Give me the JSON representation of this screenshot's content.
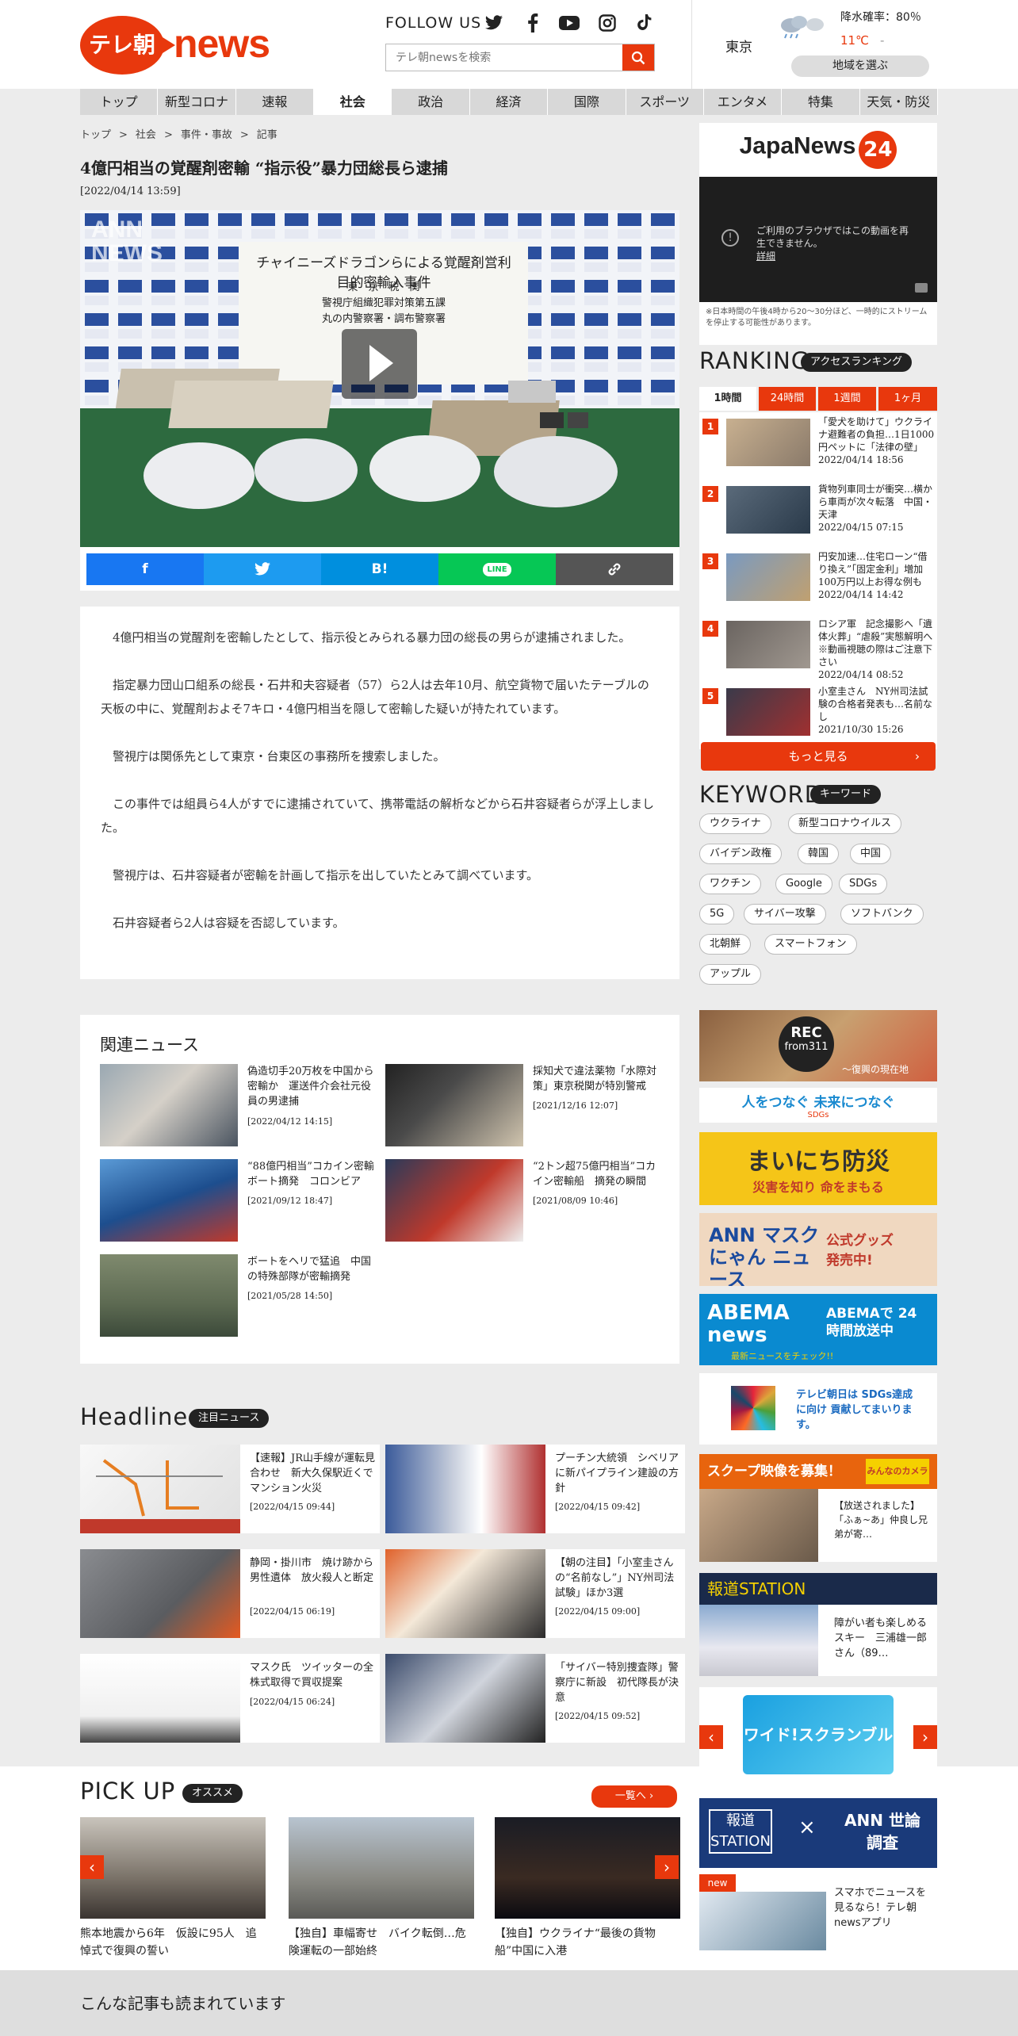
{
  "header": {
    "logo_jp": "テレ朝",
    "logo_news": "news",
    "follow": "FOLLOW US",
    "search_placeholder": "テレ朝newsを検索",
    "weather": {
      "city": "東京",
      "rain": "降水確率：80％",
      "temp": "11℃",
      "temp_low": "-",
      "region_button": "地域を選ぶ"
    }
  },
  "nav": [
    "トップ",
    "新型コロナ",
    "速報",
    "社会",
    "政治",
    "経済",
    "国際",
    "スポーツ",
    "エンタメ",
    "特集",
    "天気・防災"
  ],
  "breadcrumb": [
    "トップ",
    ">",
    "社会",
    ">",
    "事件・事故",
    ">",
    "記事"
  ],
  "article": {
    "title": "4億円相当の覚醒剤密輸 “指示役”暴力団総長ら逮捕",
    "date": "[2022/04/14 13:59]",
    "video_banner": "チャイニーズドラゴンらによる覚醒剤営利目的密輸入事件",
    "video_sub1": "東　京　税　関",
    "video_sub2": "警視庁組織犯罪対策第五課",
    "video_sub3": "丸の内警察署・調布警察署",
    "ann_logo": "ANN NEWS",
    "share_labels": {
      "facebook": "f",
      "twitter": "t",
      "hatena": "B!",
      "line": "LINE",
      "link": "🔗"
    },
    "paragraphs": [
      "4億円相当の覚醒剤を密輸したとして、指示役とみられる暴力団の総長の男らが逮捕されました。",
      "指定暴力団山口組系の総長・石井和夫容疑者（57）ら2人は去年10月、航空貨物で届いたテーブルの天板の中に、覚醒剤およそ7キロ・4億円相当を隠して密輸した疑いが持たれています。",
      "警視庁は関係先として東京・台東区の事務所を捜索しました。",
      "この事件では組員ら4人がすでに逮捕されていて、携帯電話の解析などから石井容疑者らが浮上しました。",
      "警視庁は、石井容疑者が密輸を計画して指示を出していたとみて調べています。",
      "石井容疑者ら2人は容疑を否認しています。"
    ]
  },
  "related": {
    "heading": "関連ニュース",
    "items": [
      {
        "title": "偽造切手20万枚を中国から密輸か　運送件介会社元役員の男逮捕",
        "date": "[2022/04/12 14:15]"
      },
      {
        "title": "採知犬で違法薬物「水際対策」東京税関が特別警戒",
        "date": "[2021/12/16 12:07]"
      },
      {
        "title": "“88億円相当”コカイン密輸ボート摘発　コロンビア",
        "date": "[2021/09/12 18:47]"
      },
      {
        "title": "“2トン超75億円相当”コカイン密輸船　摘発の瞬間",
        "date": "[2021/08/09 10:46]"
      },
      {
        "title": "ボートをヘリで猛追　中国の特殊部隊が密輸摘発",
        "date": "[2021/05/28 14:50]"
      }
    ]
  },
  "headline": {
    "heading": "Headline",
    "pill": "注目ニュース",
    "items": [
      {
        "title": "【速報】JR山手線が運転見合わせ　新大久保駅近くでマンション火災",
        "date": "[2022/04/15 09:44]"
      },
      {
        "title": "プーチン大統領　シベリアに新パイプライン建設の方針",
        "date": "[2022/04/15 09:42]"
      },
      {
        "title": "静岡・掛川市　焼け跡から男性遺体　放火殺人と断定",
        "date": "[2022/04/15 06:19]"
      },
      {
        "title": "【朝の注目】「小室圭さんの“名前なし”」NY州司法試験」ほか3選",
        "date": "[2022/04/15 09:00]"
      },
      {
        "title": "マスク氏　ツイッターの全株式取得で買収提案",
        "date": "[2022/04/15 06:24]"
      },
      {
        "title": "「サイバー特別捜査隊」警察庁に新設　初代隊長が決意",
        "date": "[2022/04/15 09:52]"
      }
    ]
  },
  "pickup": {
    "heading": "PICK UP",
    "pill": "オススメ",
    "more": "一覧へ",
    "items": [
      {
        "title": "熊本地震から6年　仮設に95人　追悼式で復興の誓い"
      },
      {
        "title": "【独自】車幅寄せ　バイク転倒…危険運転の一部始終"
      },
      {
        "title": "【独自】ウクライナ“最後の貨物船”中国に入港"
      }
    ]
  },
  "footer": {
    "heading": "こんな記事も読まれています"
  },
  "sidebar": {
    "japanews": {
      "logo": "JapaNews",
      "logo_num": "24",
      "error": "ご利用のブラウザではこの動画を再生できません。",
      "error_link": "詳細",
      "note": "※日本時間の午後4時から20～30分ほど、一時的にストリームを停止する可能性があります。"
    },
    "ranking": {
      "heading": "RANKING",
      "pill": "アクセスランキング",
      "tabs": [
        "1時間",
        "24時間",
        "1週間",
        "1ヶ月"
      ],
      "more": "もっと見る",
      "items": [
        {
          "num": "1",
          "title": "「愛犬を助けて」ウクライナ避難者の負担…1日1000円ペットに「法律の壁」",
          "date": "2022/04/14 18:56"
        },
        {
          "num": "2",
          "title": "貨物列車同士が衝突…横から車両が次々転落　中国・天津",
          "date": "2022/04/15 07:15"
        },
        {
          "num": "3",
          "title": "円安加速…住宅ローン“借り換え”「固定金利」増加　100万円以上お得な例も",
          "date": "2022/04/14 14:42"
        },
        {
          "num": "4",
          "title": "ロシア軍　記念撮影へ「遺体火葬」“虐殺”実態解明へ　※動画視聴の際はご注意下さい",
          "date": "2022/04/14 08:52"
        },
        {
          "num": "5",
          "title": "小室圭さん　NY州司法試験の合格者発表も…名前なし",
          "date": "2021/10/30 15:26"
        }
      ]
    },
    "keyword": {
      "heading": "KEYWORD",
      "pill": "キーワード",
      "items": [
        "ウクライナ",
        "新型コロナウイルス",
        "バイデン政権",
        "韓国",
        "中国",
        "ワクチン",
        "Google",
        "SDGs",
        "5G",
        "サイバー攻撃",
        "ソフトバンク",
        "北朝鮮",
        "スマートフォン",
        "アップル"
      ]
    },
    "banners": {
      "rec_title": "REC",
      "rec_sub": "from311",
      "rec_caption": "～復興の現在地",
      "sdgs1": "人をつなぐ 未来につなぐ",
      "sdgs1_sub": "SDGs",
      "bousai_title": "まいにち防災",
      "bousai_sub": "災害を知り 命をまもる",
      "mask_title": "ANN マスクにゃん ニュース",
      "mask_sub": "公式グッズ発売中!",
      "abema_news": "ABEMA news",
      "abema_text": "ABEMAで 24時間放送中",
      "abema_sub": "最新ニュースをチェック!!",
      "sdgs2": "テレビ朝日は SDGs達成に向け 貢献してまいります。",
      "scoop": "スクープ映像を募集！",
      "scoop_badge": "みんなのカメラ",
      "scoop_item": "【放送されました】「ふぁ~あ」仲良し兄弟が寄…",
      "hodo_title": "報道STATION",
      "hodo_item": "障がい者も楽しめるスキー　三浦雄一郎さん（89…",
      "wide": "ワイド!スクランブル",
      "survey_left": "報道 STATION",
      "survey_x": "×",
      "survey_right": "ANN 世論調査",
      "app_new": "new",
      "app_text": "スマホでニュースを見るなら！テレ朝newsアプリ"
    }
  },
  "colors": {
    "accent": "#e8380d",
    "facebook": "#1877f2",
    "twitter": "#1d9bf0",
    "hatena": "#008fde",
    "line": "#06c755",
    "link": "#555555"
  }
}
